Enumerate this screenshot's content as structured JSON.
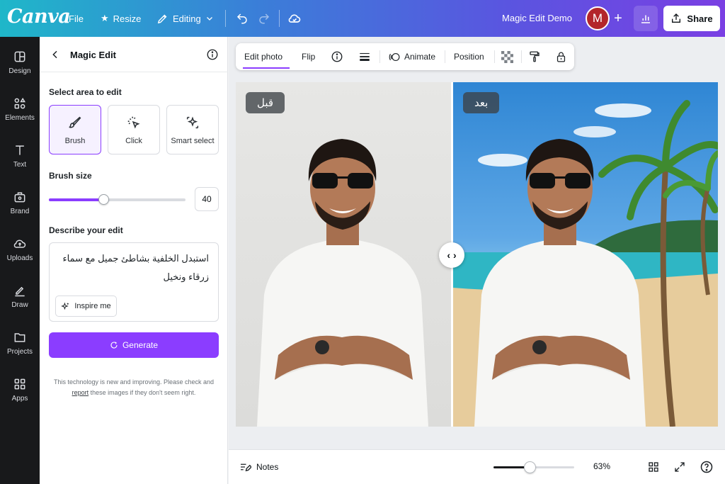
{
  "app": {
    "logo": "Canva",
    "doc_title": "Magic Edit Demo"
  },
  "topbar": {
    "file_label": "File",
    "resize_label": "Resize",
    "editing_label": "Editing",
    "avatar_initial": "M",
    "share_label": "Share",
    "icons": [
      "star-icon",
      "pencil-icon",
      "chevron-down-icon",
      "undo-icon",
      "redo-icon",
      "cloud-icon",
      "plus-icon",
      "analytics-icon",
      "upload-icon"
    ]
  },
  "rail": {
    "items": [
      {
        "label": "Design",
        "icon": "layout-icon"
      },
      {
        "label": "Elements",
        "icon": "shapes-icon"
      },
      {
        "label": "Text",
        "icon": "text-icon"
      },
      {
        "label": "Brand",
        "icon": "brand-icon"
      },
      {
        "label": "Uploads",
        "icon": "cloud-upload-icon"
      },
      {
        "label": "Draw",
        "icon": "draw-icon"
      },
      {
        "label": "Projects",
        "icon": "folder-icon"
      },
      {
        "label": "Apps",
        "icon": "apps-icon"
      }
    ]
  },
  "panel": {
    "title": "Magic Edit",
    "select_area_label": "Select area to edit",
    "tools": [
      {
        "label": "Brush",
        "icon": "brush-icon",
        "active": true
      },
      {
        "label": "Click",
        "icon": "click-icon",
        "active": false
      },
      {
        "label": "Smart select",
        "icon": "sparkle-select-icon",
        "active": false
      }
    ],
    "brush_size_label": "Brush size",
    "brush_size_value": "40",
    "brush_size_fraction": 0.4,
    "describe_label": "Describe your edit",
    "prompt_text": "استبدل الخلفية بشاطئ جميل مع سماء زرقاء ونخيل",
    "inspire_label": "Inspire me",
    "generate_label": "Generate",
    "disclaimer_before": "This technology is new and improving. Please check and",
    "disclaimer_link": "report",
    "disclaimer_after": "these images if they don't seem right."
  },
  "context_toolbar": {
    "edit_photo": "Edit photo",
    "flip": "Flip",
    "animate": "Animate",
    "position": "Position",
    "icons": [
      "info-icon",
      "border-icon",
      "animate-icon",
      "transparency-icon",
      "paint-roller-icon",
      "lock-icon"
    ]
  },
  "canvas": {
    "before_label": "قبل",
    "after_label": "بعد"
  },
  "bottombar": {
    "notes_label": "Notes",
    "zoom_pct": "63%",
    "zoom_fraction": 0.45,
    "icons": [
      "grid-view-icon",
      "fullscreen-icon",
      "help-icon"
    ]
  },
  "colors": {
    "accent": "#8b3dff",
    "rail_bg": "#18191b"
  }
}
